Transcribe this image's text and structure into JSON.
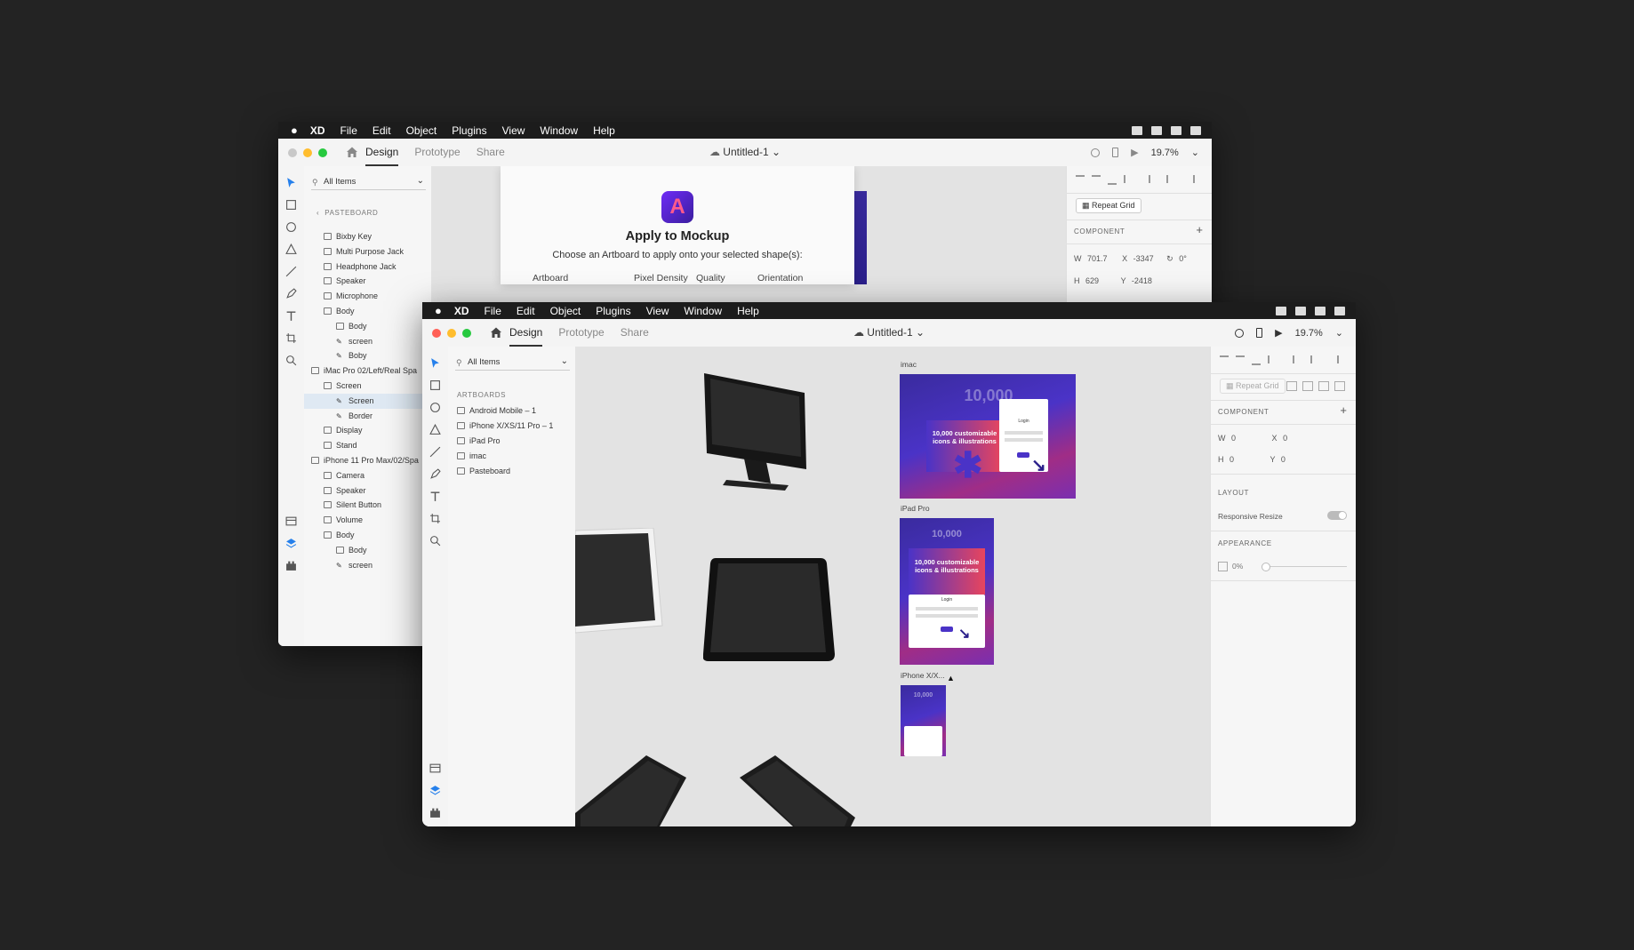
{
  "colors": {
    "accent": "#2680eb",
    "mac_red": "#ff5f56",
    "mac_yellow": "#ffbd2e",
    "mac_green": "#27c93f",
    "mockup_purple": "#4a33c7"
  },
  "menubar": {
    "apple": "",
    "app": "XD",
    "items": [
      "File",
      "Edit",
      "Object",
      "Plugins",
      "View",
      "Window",
      "Help"
    ]
  },
  "back": {
    "tabs": [
      "Design",
      "Prototype",
      "Share"
    ],
    "doc_title": "Untitled-1 ⌄",
    "zoom": "19.7%",
    "search_label": "All Items",
    "section": "PASTEBOARD",
    "layers": [
      "Bixby Key",
      "Multi Purpose Jack",
      "Headphone Jack",
      "Speaker",
      "Microphone",
      "Body",
      "Body",
      "screen",
      "Boby",
      "iMac Pro 02/Left/Real Spa",
      "Screen",
      "Screen",
      "Border",
      "Display",
      "Stand",
      "iPhone 11 Pro Max/02/Spa",
      "Camera",
      "Speaker",
      "Silent Button",
      "Volume",
      "Body",
      "Body",
      "screen"
    ],
    "dialog": {
      "logo_letter": "A",
      "title": "Apply to Mockup",
      "subtitle": "Choose an Artboard to apply onto your selected shape(s):",
      "columns": [
        "Artboard",
        "Pixel Density",
        "Quality",
        "Orientation"
      ]
    },
    "props": {
      "repeat_grid": "Repeat Grid",
      "component": "COMPONENT",
      "w_label": "W",
      "w": "701.7",
      "x_label": "X",
      "x": "-3347",
      "rot": "0°",
      "h_label": "H",
      "h": "629",
      "y_label": "Y",
      "y": "-2418"
    }
  },
  "front": {
    "tabs": [
      "Design",
      "Prototype",
      "Share"
    ],
    "doc_title": "Untitled-1 ⌄",
    "zoom": "19.7%",
    "search_label": "All Items",
    "section": "ARTBOARDS",
    "artboards": [
      "Android Mobile – 1",
      "iPhone X/XS/11 Pro – 1",
      "iPad Pro",
      "imac",
      "Pasteboard"
    ],
    "canvas_labels": [
      "imac",
      "iPad Pro",
      "iPhone X/X..."
    ],
    "thumb_text": {
      "big": "10,000",
      "line": "10,000 customizable icons & illustrations",
      "login": "Login"
    },
    "props": {
      "repeat_grid": "Repeat Grid",
      "component": "COMPONENT",
      "w_label": "W",
      "w": "0",
      "x_label": "X",
      "x": "0",
      "h_label": "H",
      "h": "0",
      "y_label": "Y",
      "y": "0",
      "layout": "LAYOUT",
      "responsive": "Responsive Resize",
      "appearance": "APPEARANCE",
      "opacity": "0%"
    }
  }
}
